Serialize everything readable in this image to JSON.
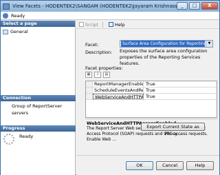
{
  "window": {
    "title": "View Facets - HODENTEK2\\SANGAM (HODENTEK2\\Jayaram Krishnaswamy)",
    "minimize": "_",
    "maximize": "□",
    "close": "X"
  },
  "status": {
    "text": "Ready"
  },
  "left": {
    "select_page_header": "Select a page",
    "pages": [
      {
        "label": "General"
      }
    ],
    "connection_header": "Connection",
    "connection_text": "Group of ReportServer servers",
    "progress_header": "Progress",
    "progress_text": "Ready"
  },
  "toolbar": {
    "script_label": "Script",
    "help_label": "Help"
  },
  "facet": {
    "label": "Facet:",
    "selected": "Surface Area Configuration for Reporting Ser",
    "description_label": "Description:",
    "description": "Exposes the surface area configuration properties of the Reporting Services features."
  },
  "properties": {
    "label": "Facet properties:",
    "rows": [
      {
        "name": "ReportManagerEnabled",
        "value": "True"
      },
      {
        "name": "ScheduleEventsAndReportDel",
        "value": "True"
      },
      {
        "name": "WebServiceAndHTTPAccessE",
        "value": "True"
      }
    ]
  },
  "help_panel": {
    "title": "WebServiceAndHTTPAccessEnabled",
    "text": "The Report Server Web service can receive Simple Object Access Protocol (SOAP) requests and URL access requests. Enable Web ..."
  },
  "buttons": {
    "export": "Export Current State as Policy...",
    "ok": "OK",
    "cancel": "Cancel",
    "help": "Help"
  }
}
